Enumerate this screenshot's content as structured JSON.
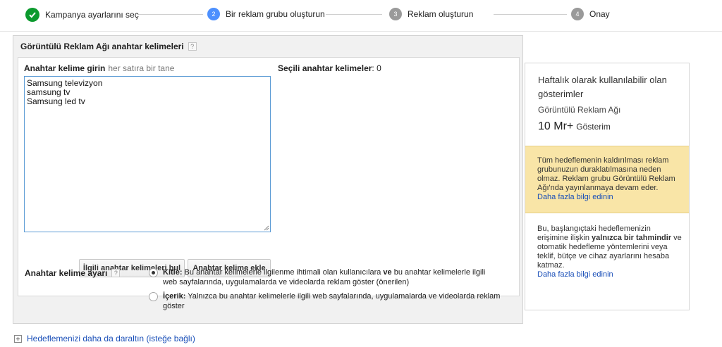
{
  "steps": [
    {
      "label": "Kampanya ayarlarını seç",
      "state": "done"
    },
    {
      "number": "2",
      "label": "Bir reklam grubu oluşturun",
      "state": "active"
    },
    {
      "number": "3",
      "label": "Reklam oluşturun",
      "state": "pending"
    },
    {
      "number": "4",
      "label": "Onay",
      "state": "pending"
    }
  ],
  "panel": {
    "title": "Görüntülü Reklam Ağı anahtar kelimeleri",
    "help": "?",
    "input_label": "Anahtar kelime girin",
    "input_hint": "her satıra bir tane",
    "selected_label": "Seçili anahtar kelimeler",
    "selected_count": ": 0",
    "keywords": [
      "Samsung televizyon",
      "samsung tv",
      "Samsung led tv"
    ],
    "btn_find": "İlgili anahtar kelimeleri bul",
    "btn_add": "Anahtar kelime ekle",
    "match_label": "Anahtar kelime ayarı",
    "options": {
      "audience_title": "Kitle:",
      "audience_text_a": " Bu anahtar kelimelerle ilgilenme ihtimali olan kullanıcılara ",
      "audience_bold": "ve",
      "audience_text_b": " bu anahtar kelimelerle ilgili web sayfalarında, uygulamalarda ve videolarda reklam göster (önerilen)",
      "content_title": "İçerik:",
      "content_text": " Yalnızca bu anahtar kelimelerle ilgili web sayfalarında, uygulamalarda ve videolarda reklam göster"
    }
  },
  "expander": {
    "label": "Hedeflemenizi daha da daraltın (isteğe bağlı)"
  },
  "card": {
    "heading": "Haftalık olarak kullanılabilir olan gösterimler",
    "sub": "Görüntülü Reklam Ağı",
    "stat_value": "10 Mr+",
    "stat_unit": "Gösterim",
    "warning": "Tüm hedeflemenin kaldırılması reklam grubunuzun duraklatılmasına neden olmaz. Reklam grubu Görüntülü Reklam Ağı'nda yayınlanmaya devam eder.",
    "warning_link": "Daha fazla bilgi edinin",
    "info_a": "Bu, başlangıçtaki hedeflemenizin erişimine ilişkin ",
    "info_bold": "yalnızca bir tahmindir",
    "info_b": " ve otomatik hedefleme yöntemlerini veya teklif, bütçe ve cihaz ayarlarını hesaba katmaz.",
    "info_link": "Daha fazla bilgi edinin"
  },
  "colors": {
    "accent": "#4d90fe",
    "done": "#0c9a2e",
    "warning_bg": "#f9e5a7",
    "link": "#1a4fb8"
  }
}
